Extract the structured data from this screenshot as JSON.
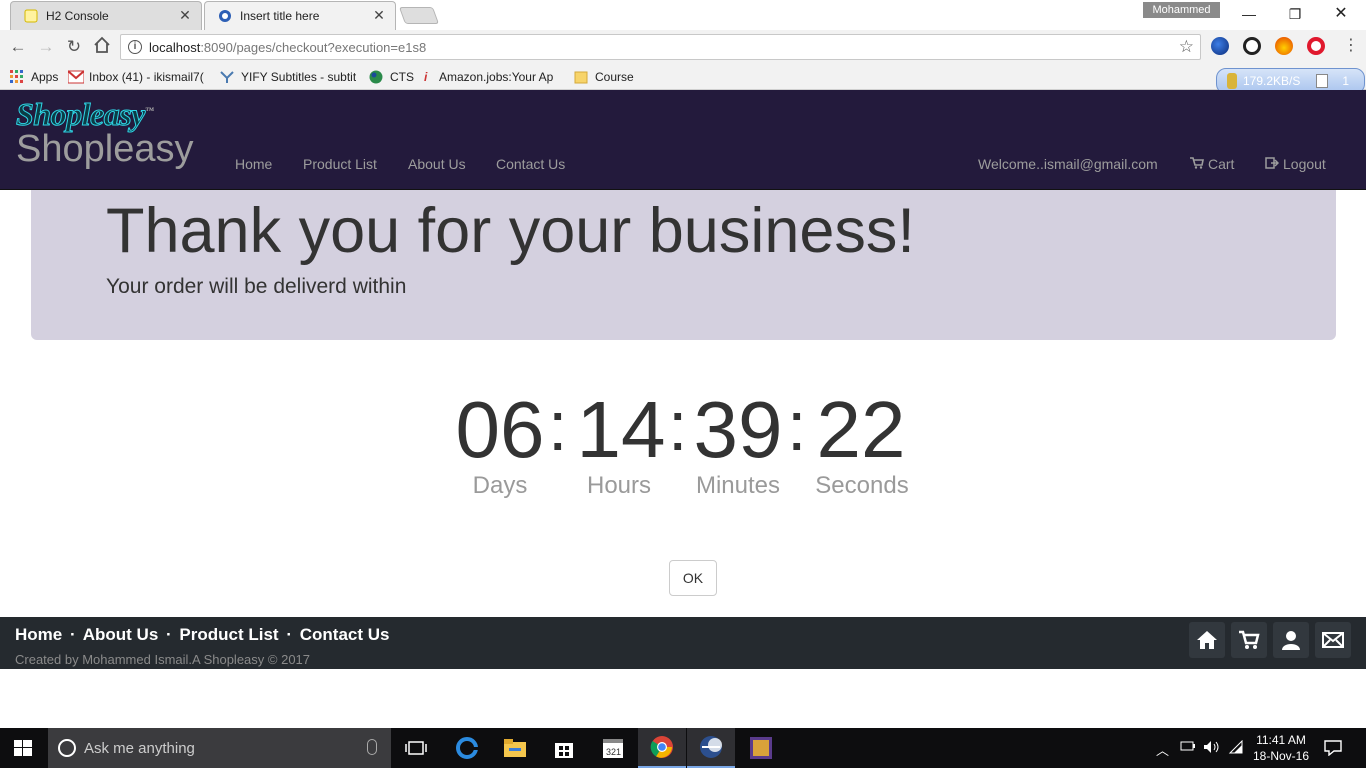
{
  "browser": {
    "tabs": [
      {
        "title": "H2 Console",
        "active": false
      },
      {
        "title": "Insert title here",
        "active": true
      }
    ],
    "profile_name": "Mohammed",
    "url_host": "localhost",
    "url_rest": ":8090/pages/checkout?execution=e1s8",
    "bookmarks": [
      {
        "label": "Apps"
      },
      {
        "label": "Inbox (41) - ikismail7("
      },
      {
        "label": "YIFY Subtitles - subtitl"
      },
      {
        "label": "CTS"
      },
      {
        "label": "Amazon.jobs:Your Ap"
      },
      {
        "label": "Course"
      }
    ],
    "speed_meter": {
      "rate": "179.2KB/S",
      "count": "1"
    }
  },
  "site": {
    "logo_text": "Shopleasy",
    "logo_tm": "™",
    "brand": "Shopleasy",
    "nav": {
      "home": "Home",
      "product_list": "Product List",
      "about": "About Us",
      "contact": "Contact Us",
      "welcome": "Welcome..ismail@gmail.com",
      "cart": "Cart",
      "logout": "Logout"
    }
  },
  "jumbotron": {
    "heading": "Thank you for your business!",
    "message": "Your order will be deliverd within"
  },
  "countdown": {
    "days": "06",
    "hours": "14",
    "minutes": "39",
    "seconds": "22",
    "separator": ":",
    "labels": {
      "days": "Days",
      "hours": "Hours",
      "minutes": "Minutes",
      "seconds": "Seconds"
    }
  },
  "ok_button": "OK",
  "footer": {
    "links": [
      "Home",
      "About Us",
      "Product List",
      "Contact Us"
    ],
    "separator": "·",
    "copyright": "Created by Mohammed Ismail.A Shopleasy © 2017"
  },
  "taskbar": {
    "search_placeholder": "Ask me anything",
    "time": "11:41 AM",
    "date": "18-Nov-16"
  },
  "colors": {
    "navbar_bg": "#231a3c",
    "jumbotron_bg": "#d4d0df",
    "footer_bg": "#252a2f",
    "logo_accent": "#2fd6e6"
  }
}
